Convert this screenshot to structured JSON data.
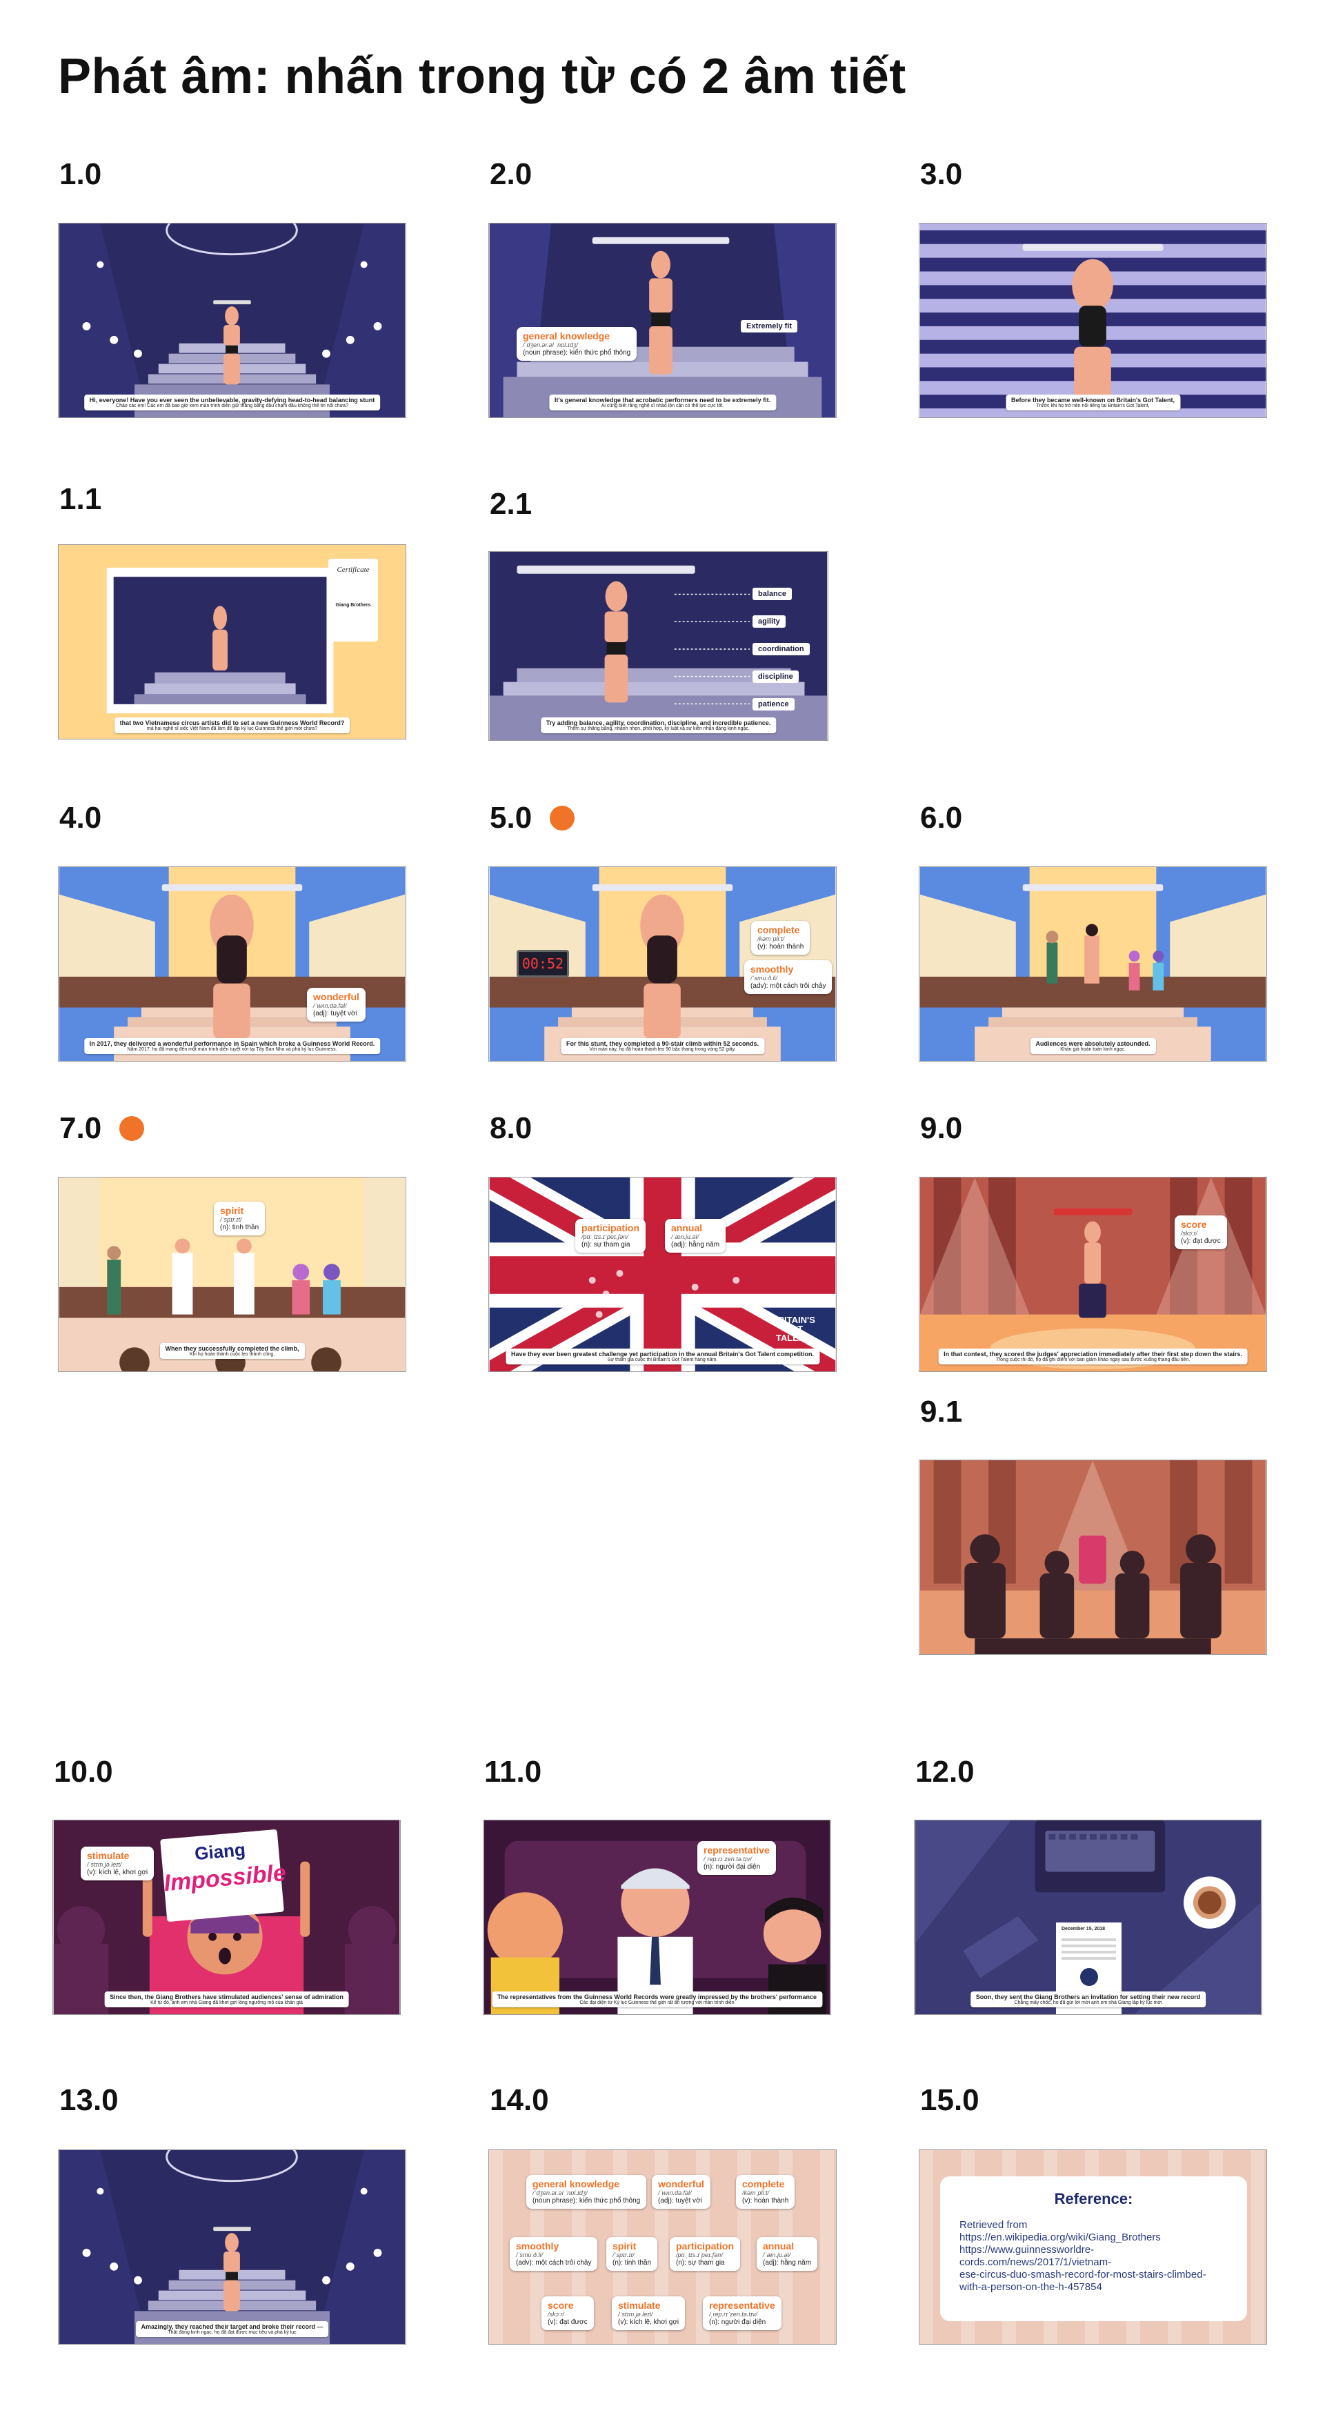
{
  "page": {
    "title": "Phát âm: nhấn trong từ có 2 âm tiết"
  },
  "frames": {
    "f1_0": {
      "label": "1.0",
      "caption": "Hi, everyone! Have you ever seen the unbelievable, gravity-defying head-to-head balancing stunt",
      "caption_vi": "Chào các em! Các em đã bao giờ xem màn trình diễn giữ thăng bằng đầu chạm đầu không thể tin nổi chưa?"
    },
    "f2_0": {
      "label": "2.0",
      "caption": "It's general knowledge that acrobatic performers need to be extremely fit.",
      "caption_vi": "Ai cũng biết rằng nghệ sĩ nhào lộn cần có thể lực cực tốt.",
      "tag": "Extremely fit",
      "vocab": {
        "word": "general knowledge",
        "ipa": "/ˈdʒen.ər.əl ˈnɒl.ɪdʒ/",
        "meaning": "(noun phrase): kiến thức phổ thông"
      }
    },
    "f3_0": {
      "label": "3.0",
      "caption": "Before they became well-known on Britain's Got Talent,",
      "caption_vi": "Trước khi họ trở nên nổi tiếng tại Britain's Got Talent,"
    },
    "f1_1": {
      "label": "1.1",
      "caption": "that two Vietnamese circus artists did to set a new Guinness World Record?",
      "caption_vi": "mà hai nghệ sĩ xiếc Việt Nam đã làm để lập kỷ lục Guinness thế giới mới chưa?",
      "cert_title": "Certificate",
      "cert_name": "Giang Brothers"
    },
    "f2_1": {
      "label": "2.1",
      "caption": "Try adding balance, agility, coordination, discipline, and incredible patience.",
      "caption_vi": "Thêm sự thăng bằng, nhanh nhẹn, phối hợp, kỷ luật và sự kiên nhẫn đáng kinh ngạc.",
      "tags": [
        "balance",
        "agility",
        "coordination",
        "discipline",
        "patience"
      ]
    },
    "f4_0": {
      "label": "4.0",
      "caption": "In 2017, they delivered a wonderful performance in Spain which broke a Guinness World Record.",
      "caption_vi": "Năm 2017, họ đã mang đến một màn trình diễn tuyệt vời tại Tây Ban Nha và phá kỷ lục Guinness.",
      "vocab": {
        "word": "wonderful",
        "ipa": "/ˈwʌn.də.fəl/",
        "meaning": "(adj): tuyệt vời"
      }
    },
    "f5_0": {
      "label": "5.0",
      "caption": "For this stunt, they completed a 90-stair climb within 52 seconds.",
      "caption_vi": "Với màn này, họ đã hoàn thành leo 90 bậc thang trong vòng 52 giây.",
      "timer": "00:52",
      "vocab1": {
        "word": "complete",
        "ipa": "/kəmˈpliːt/",
        "meaning": "(v): hoàn thành"
      },
      "vocab2": {
        "word": "smoothly",
        "ipa": "/ˈsmuːð.li/",
        "meaning": "(adv): một cách trôi chảy"
      }
    },
    "f6_0": {
      "label": "6.0",
      "caption": "Audiences were absolutely astounded.",
      "caption_vi": "Khán giả hoàn toàn kinh ngạc."
    },
    "f7_0": {
      "label": "7.0",
      "caption": "When they successfully completed the climb,",
      "caption_vi": "Khi họ hoàn thành cuộc leo thành công,",
      "vocab": {
        "word": "spirit",
        "ipa": "/ˈspɪr.ɪt/",
        "meaning": "(n): tinh thần"
      }
    },
    "f8_0": {
      "label": "8.0",
      "caption": "Have they ever been greatest challenge yet participation in the annual Britain's Got Talent competition.",
      "caption_vi": "Sự tham gia cuộc thi Britain's Got Talent hàng năm.",
      "stage_text": "BRITAIN'S GOT TALENT",
      "vocab1": {
        "word": "participation",
        "ipa": "/pɑːˌtɪs.ɪˈpeɪ.ʃən/",
        "meaning": "(n): sự tham gia"
      },
      "vocab2": {
        "word": "annual",
        "ipa": "/ˈæn.ju.əl/",
        "meaning": "(adj): hằng năm"
      }
    },
    "f9_0": {
      "label": "9.0",
      "caption": "In that contest, they scored the judges' appreciation immediately after their first step down the stairs.",
      "caption_vi": "Trong cuộc thi đó, họ đã ghi điểm với ban giám khảo ngay sau bước xuống thang đầu tiên.",
      "vocab": {
        "word": "score",
        "ipa": "/skɔːr/",
        "meaning": "(v): đạt được"
      }
    },
    "f9_1": {
      "label": "9.1"
    },
    "f10_0": {
      "label": "10.0",
      "caption": "Since then, the Giang Brothers have stimulated audiences' sense of admiration",
      "caption_vi": "Kể từ đó, anh em nhà Giang đã khơi gợi lòng ngưỡng mộ của khán giả",
      "sign_top": "Giang",
      "sign_bottom": "Impossible",
      "vocab": {
        "word": "stimulate",
        "ipa": "/ˈstɪm.jə.leɪt/",
        "meaning": "(v): kích lệ, khơi gợi"
      }
    },
    "f11_0": {
      "label": "11.0",
      "caption": "The representatives from the Guinness World Records were greatly impressed by the brothers' performance",
      "caption_vi": "Các đại diện từ Kỷ lục Guinness thế giới rất ấn tượng với màn trình diễn",
      "vocab": {
        "word": "representative",
        "ipa": "/ˌrep.rɪˈzen.tə.tɪv/",
        "meaning": "(n): người đại diện"
      }
    },
    "f12_0": {
      "label": "12.0",
      "caption": "Soon, they sent the Giang Brothers an invitation for setting their new record",
      "caption_vi": "Chẳng mấy chốc, họ đã gửi lời mời anh em nhà Giang lập kỷ lục mới",
      "letter_date": "December 15, 2018"
    },
    "f13_0": {
      "label": "13.0",
      "caption": "Amazingly, they reached their target and broke their record —",
      "caption_vi": "Thật đáng kinh ngạc, họ đã đạt được mục tiêu và phá kỷ lục"
    },
    "f14_0": {
      "label": "14.0",
      "cards": [
        {
          "word": "general knowledge",
          "ipa": "/ˈdʒen.ər.əl ˈnɒl.ɪdʒ/",
          "meaning": "(noun phrase): kiến thức phổ thông"
        },
        {
          "word": "wonderful",
          "ipa": "/ˈwʌn.də.fəl/",
          "meaning": "(adj): tuyệt vời"
        },
        {
          "word": "complete",
          "ipa": "/kəmˈpliːt/",
          "meaning": "(v): hoàn thành"
        },
        {
          "word": "smoothly",
          "ipa": "/ˈsmuːð.li/",
          "meaning": "(adv): một cách trôi chảy"
        },
        {
          "word": "spirit",
          "ipa": "/ˈspɪr.ɪt/",
          "meaning": "(n): tinh thần"
        },
        {
          "word": "participation",
          "ipa": "/pɑːˌtɪs.ɪˈpeɪ.ʃən/",
          "meaning": "(n): sự tham gia"
        },
        {
          "word": "annual",
          "ipa": "/ˈæn.ju.əl/",
          "meaning": "(adj): hằng năm"
        },
        {
          "word": "score",
          "ipa": "/skɔːr/",
          "meaning": "(v): đạt được"
        },
        {
          "word": "stimulate",
          "ipa": "/ˈstɪm.jə.leɪt/",
          "meaning": "(v): kích lệ, khơi gợi"
        },
        {
          "word": "representative",
          "ipa": "/ˌrep.rɪˈzen.tə.tɪv/",
          "meaning": "(n): người đại diện"
        }
      ]
    },
    "f15_0": {
      "label": "15.0",
      "ref_title": "Reference:",
      "ref_lines": [
        "Retrieved from",
        "https://en.wikipedia.org/wiki/Giang_Brothers",
        "https://www.guinnessworldre-",
        "cords.com/news/2017/1/vietnam-",
        "ese-circus-duo-smash-record-for-most-stairs-climbed-",
        "with-a-person-on-the-h-457854"
      ]
    }
  },
  "colors": {
    "accent": "#f07328",
    "night": "#2b2a63",
    "stairs": "#a7a5c9"
  }
}
